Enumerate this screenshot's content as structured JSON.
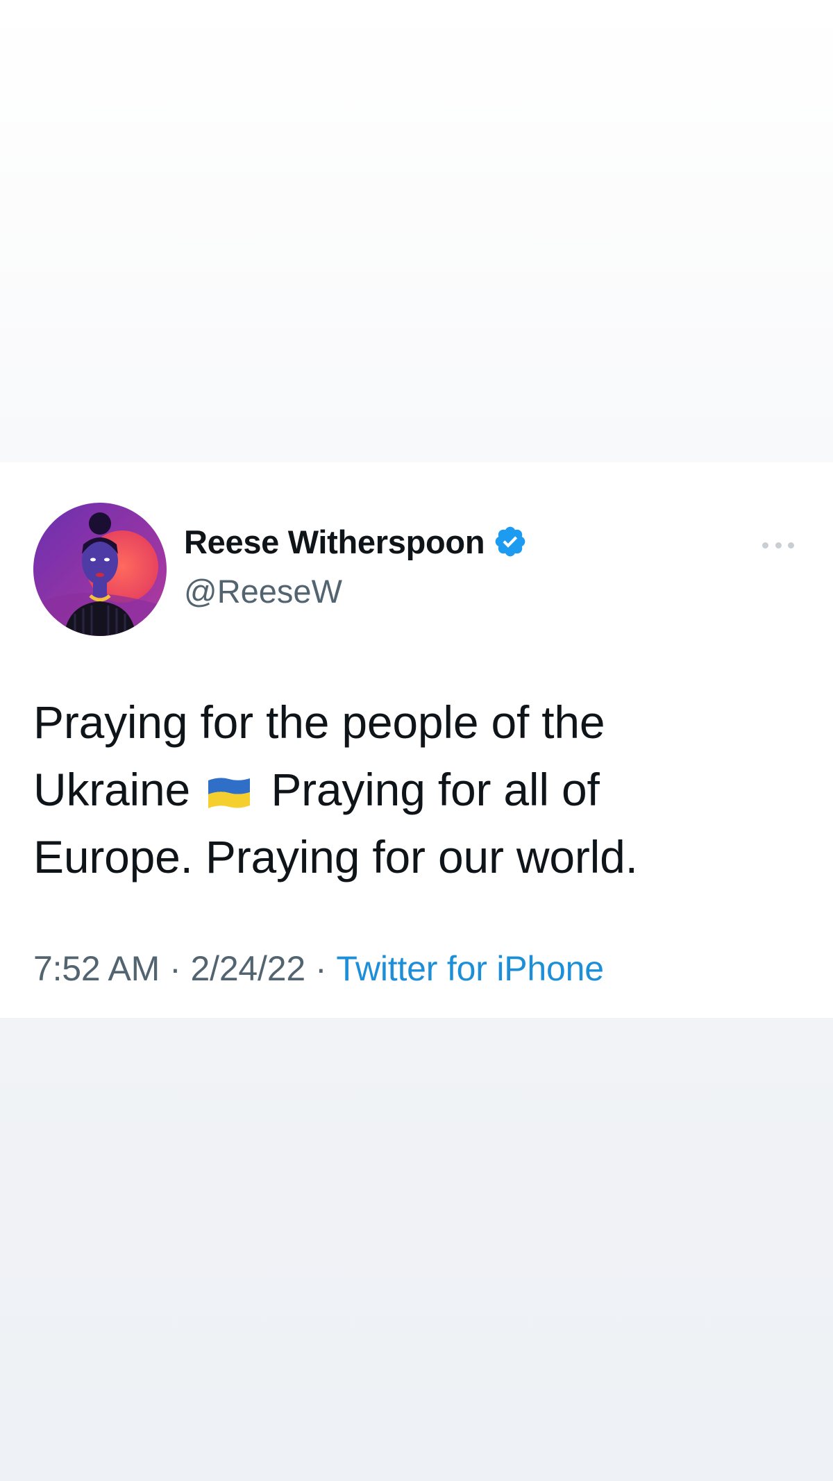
{
  "tweet": {
    "author": {
      "display_name": "Reese Witherspoon",
      "handle": "@ReeseW",
      "verified": true,
      "avatar_icon": "illustrated-avatar"
    },
    "text_lines": [
      "Praying for the people of the",
      [
        "Ukraine",
        "Praying for all of"
      ],
      "Europe. Praying for our world."
    ],
    "emoji": "ukraine-flag-icon",
    "time": "7:52 AM",
    "separator": "·",
    "date": "2/24/22",
    "source": "Twitter for iPhone"
  },
  "colors": {
    "text_primary": "#0f1419",
    "text_secondary": "#536471",
    "link": "#1d8fd8",
    "verified": "#1d9bf0",
    "flag_blue": "#2f6fc7",
    "flag_yellow": "#f5cf2e"
  }
}
